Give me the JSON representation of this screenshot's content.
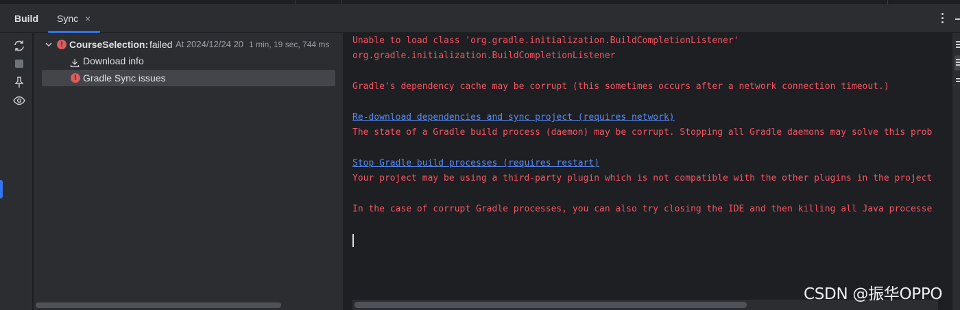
{
  "tabs": {
    "build_label": "Build",
    "sync_label": "Sync",
    "sync_close": "×"
  },
  "left_toolbar": {
    "icons": [
      "sync-icon",
      "stop-icon",
      "pin-icon",
      "eye-icon"
    ]
  },
  "tree": {
    "root": {
      "title": "CourseSelection:",
      "status": "failed",
      "timestamp": "At 2024/12/24 20",
      "duration": "1 min, 19 sec, 744 ms"
    },
    "children": [
      {
        "label": "Download info",
        "icon": "download-icon"
      },
      {
        "label": "Gradle Sync issues",
        "icon": "error-icon",
        "selected": true
      }
    ]
  },
  "console": {
    "lines": [
      {
        "text": "Unable to load class 'org.gradle.initialization.BuildCompletionListener'",
        "type": "error"
      },
      {
        "text": "org.gradle.initialization.BuildCompletionListener",
        "type": "error"
      },
      {
        "text": "",
        "type": "blank"
      },
      {
        "text": "Gradle's dependency cache may be corrupt (this sometimes occurs after a network connection timeout.)",
        "type": "error"
      },
      {
        "text": "",
        "type": "blank"
      },
      {
        "text": "Re-download dependencies and sync project (requires network)",
        "type": "link"
      },
      {
        "text": "The state of a Gradle build process (daemon) may be corrupt. Stopping all Gradle daemons may solve this prob",
        "type": "error"
      },
      {
        "text": "",
        "type": "blank"
      },
      {
        "text": "Stop Gradle build processes (requires restart)",
        "type": "link"
      },
      {
        "text": "Your project may be using a third-party plugin which is not compatible with the other plugins in the project",
        "type": "error"
      },
      {
        "text": "",
        "type": "blank"
      },
      {
        "text": "In the case of corrupt Gradle processes, you can also try closing the IDE and then killing all Java processe",
        "type": "error"
      }
    ]
  },
  "colors": {
    "error_text": "#f75464",
    "link_text": "#548af7",
    "accent": "#3574f0",
    "error_icon": "#db5c5c"
  },
  "watermark": "CSDN @振华OPPO"
}
